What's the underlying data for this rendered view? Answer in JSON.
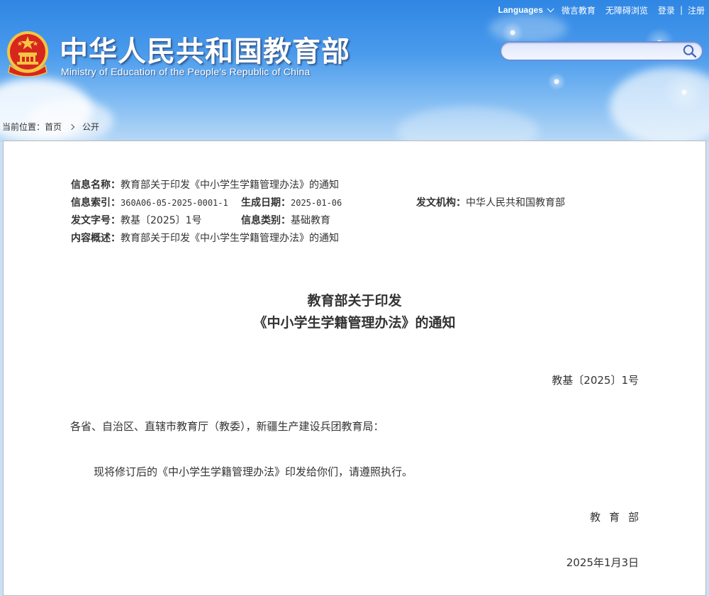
{
  "header": {
    "site_title": "中华人民共和国教育部",
    "site_subtitle": "Ministry of Education of the People's Republic of China",
    "topbar": {
      "languages": "Languages",
      "weibo": "微言教育",
      "accessibility": "无障碍浏览",
      "login": "登录",
      "separator": "|",
      "register": "注册"
    },
    "search": {
      "value": "",
      "placeholder": ""
    }
  },
  "breadcrumb": {
    "prefix": "当前位置：",
    "home": "首页",
    "current": "公开"
  },
  "meta": {
    "info_name_label": "信息名称：",
    "info_name_value": "教育部关于印发《中小学生学籍管理办法》的通知",
    "index_label": "信息索引：",
    "index_value": "360A06-05-2025-0001-1",
    "generated_date_label": "生成日期：",
    "generated_date_value": "2025-01-06",
    "issuer_label": "发文机构：",
    "issuer_value": "中华人民共和国教育部",
    "doc_no_label": "发文字号：",
    "doc_no_value": "教基〔2025〕1号",
    "category_label": "信息类别：",
    "category_value": "基础教育",
    "summary_label": "内容概述：",
    "summary_value": "教育部关于印发《中小学生学籍管理办法》的通知"
  },
  "document": {
    "title_line1": "教育部关于印发",
    "title_line2": "《中小学生学籍管理办法》的通知",
    "doc_number": "教基〔2025〕1号",
    "addressee": "各省、自治区、直辖市教育厅（教委），新疆生产建设兵团教育局：",
    "body": "现将修订后的《中小学生学籍管理办法》印发给你们，请遵照执行。",
    "signature": "教育部",
    "date": "2025年1月3日"
  },
  "colors": {
    "header_top": "#2f86e3",
    "header_bottom": "#b7d8f6",
    "emblem_red": "#d7261e",
    "emblem_gold": "#f4c542",
    "search_border": "#6b8ed6",
    "content_border": "#b9b9b9"
  },
  "icons": {
    "emblem": "national-emblem-icon",
    "search": "search-icon",
    "languages_caret": "chevron-down-icon",
    "breadcrumb_separator": "chevron-right-icon"
  }
}
